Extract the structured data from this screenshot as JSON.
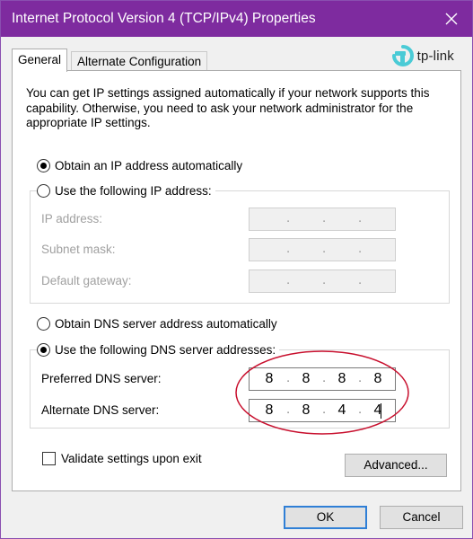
{
  "window": {
    "title": "Internet Protocol Version 4 (TCP/IPv4) Properties",
    "close_glyph": "✕",
    "title_bar_color": "#7e2b9f"
  },
  "tabs": [
    {
      "label": "General",
      "active": true
    },
    {
      "label": "Alternate Configuration",
      "active": false
    }
  ],
  "brand": {
    "name": "tp-link",
    "color": "#4acbd6"
  },
  "general": {
    "description": "You can get IP settings assigned automatically if your network supports this capability. Otherwise, you need to ask your network administrator for the appropriate IP settings.",
    "ip_auto_label": "Obtain an IP address automatically",
    "ip_manual_label": "Use the following IP address:",
    "ip_mode": "auto",
    "ip_fields": [
      {
        "label": "IP address:",
        "value": [
          "",
          "",
          "",
          ""
        ]
      },
      {
        "label": "Subnet mask:",
        "value": [
          "",
          "",
          "",
          ""
        ]
      },
      {
        "label": "Default gateway:",
        "value": [
          "",
          "",
          "",
          ""
        ]
      }
    ],
    "dns_auto_label": "Obtain DNS server address automatically",
    "dns_manual_label": "Use the following DNS server addresses:",
    "dns_mode": "manual",
    "dns_fields": [
      {
        "label": "Preferred DNS server:",
        "value": [
          "8",
          "8",
          "8",
          "8"
        ]
      },
      {
        "label": "Alternate DNS server:",
        "value": [
          "8",
          "8",
          "4",
          "4"
        ]
      }
    ],
    "validate_label": "Validate settings upon exit",
    "validate_checked": false,
    "advanced_label": "Advanced...",
    "annotation_color": "#c8102e"
  },
  "buttons": {
    "ok": "OK",
    "cancel": "Cancel"
  }
}
